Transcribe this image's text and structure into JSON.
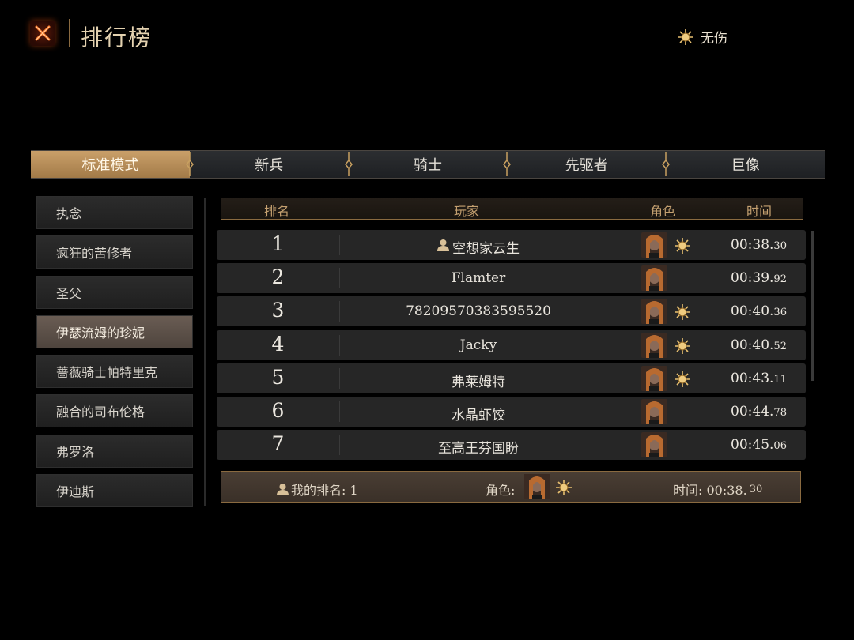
{
  "header": {
    "title": "排行榜",
    "no_hit_label": "无伤"
  },
  "tabs": [
    {
      "label": "标准模式",
      "active": true
    },
    {
      "label": "新兵",
      "active": false
    },
    {
      "label": "骑士",
      "active": false
    },
    {
      "label": "先驱者",
      "active": false
    },
    {
      "label": "巨像",
      "active": false
    }
  ],
  "bosses": [
    {
      "label": "执念"
    },
    {
      "label": "疯狂的苦修者"
    },
    {
      "label": "圣父"
    },
    {
      "label": "伊瑟流姆的珍妮",
      "active": true
    },
    {
      "label": "蔷薇骑士帕特里克"
    },
    {
      "label": "融合的司布伦格"
    },
    {
      "label": "弗罗洛"
    },
    {
      "label": "伊迪斯"
    }
  ],
  "columns": {
    "rank": "排名",
    "player": "玩家",
    "character": "角色",
    "time": "时间"
  },
  "rows": [
    {
      "rank": "1",
      "player": "空想家云生",
      "self": true,
      "no_hit": true,
      "time_main": "00:38.",
      "time_ms": "30"
    },
    {
      "rank": "2",
      "player": "Flamter",
      "self": false,
      "no_hit": false,
      "time_main": "00:39.",
      "time_ms": "92"
    },
    {
      "rank": "3",
      "player": "78209570383595520",
      "self": false,
      "no_hit": true,
      "time_main": "00:40.",
      "time_ms": "36"
    },
    {
      "rank": "4",
      "player": "Jacky",
      "self": false,
      "no_hit": true,
      "time_main": "00:40.",
      "time_ms": "52"
    },
    {
      "rank": "5",
      "player": "弗莱姆特",
      "self": false,
      "no_hit": true,
      "time_main": "00:43.",
      "time_ms": "11"
    },
    {
      "rank": "6",
      "player": "水晶虾饺",
      "self": false,
      "no_hit": false,
      "time_main": "00:44.",
      "time_ms": "78"
    },
    {
      "rank": "7",
      "player": "至高王芬国盼",
      "self": false,
      "no_hit": false,
      "time_main": "00:45.",
      "time_ms": "06"
    }
  ],
  "my_rank": {
    "rank_label": "我的排名: 1",
    "character_label": "角色:",
    "time_label": "时间: 00:38.",
    "time_ms": "30",
    "no_hit": true
  },
  "icons": {
    "close": "close-x-icon",
    "no_hit": "sun-emblem-icon",
    "player": "person-icon",
    "character": "character-portrait"
  },
  "colors": {
    "accent_gold": "#c4a070",
    "active_tab": "#b68c58",
    "close_orange": "#ff7a2a"
  }
}
